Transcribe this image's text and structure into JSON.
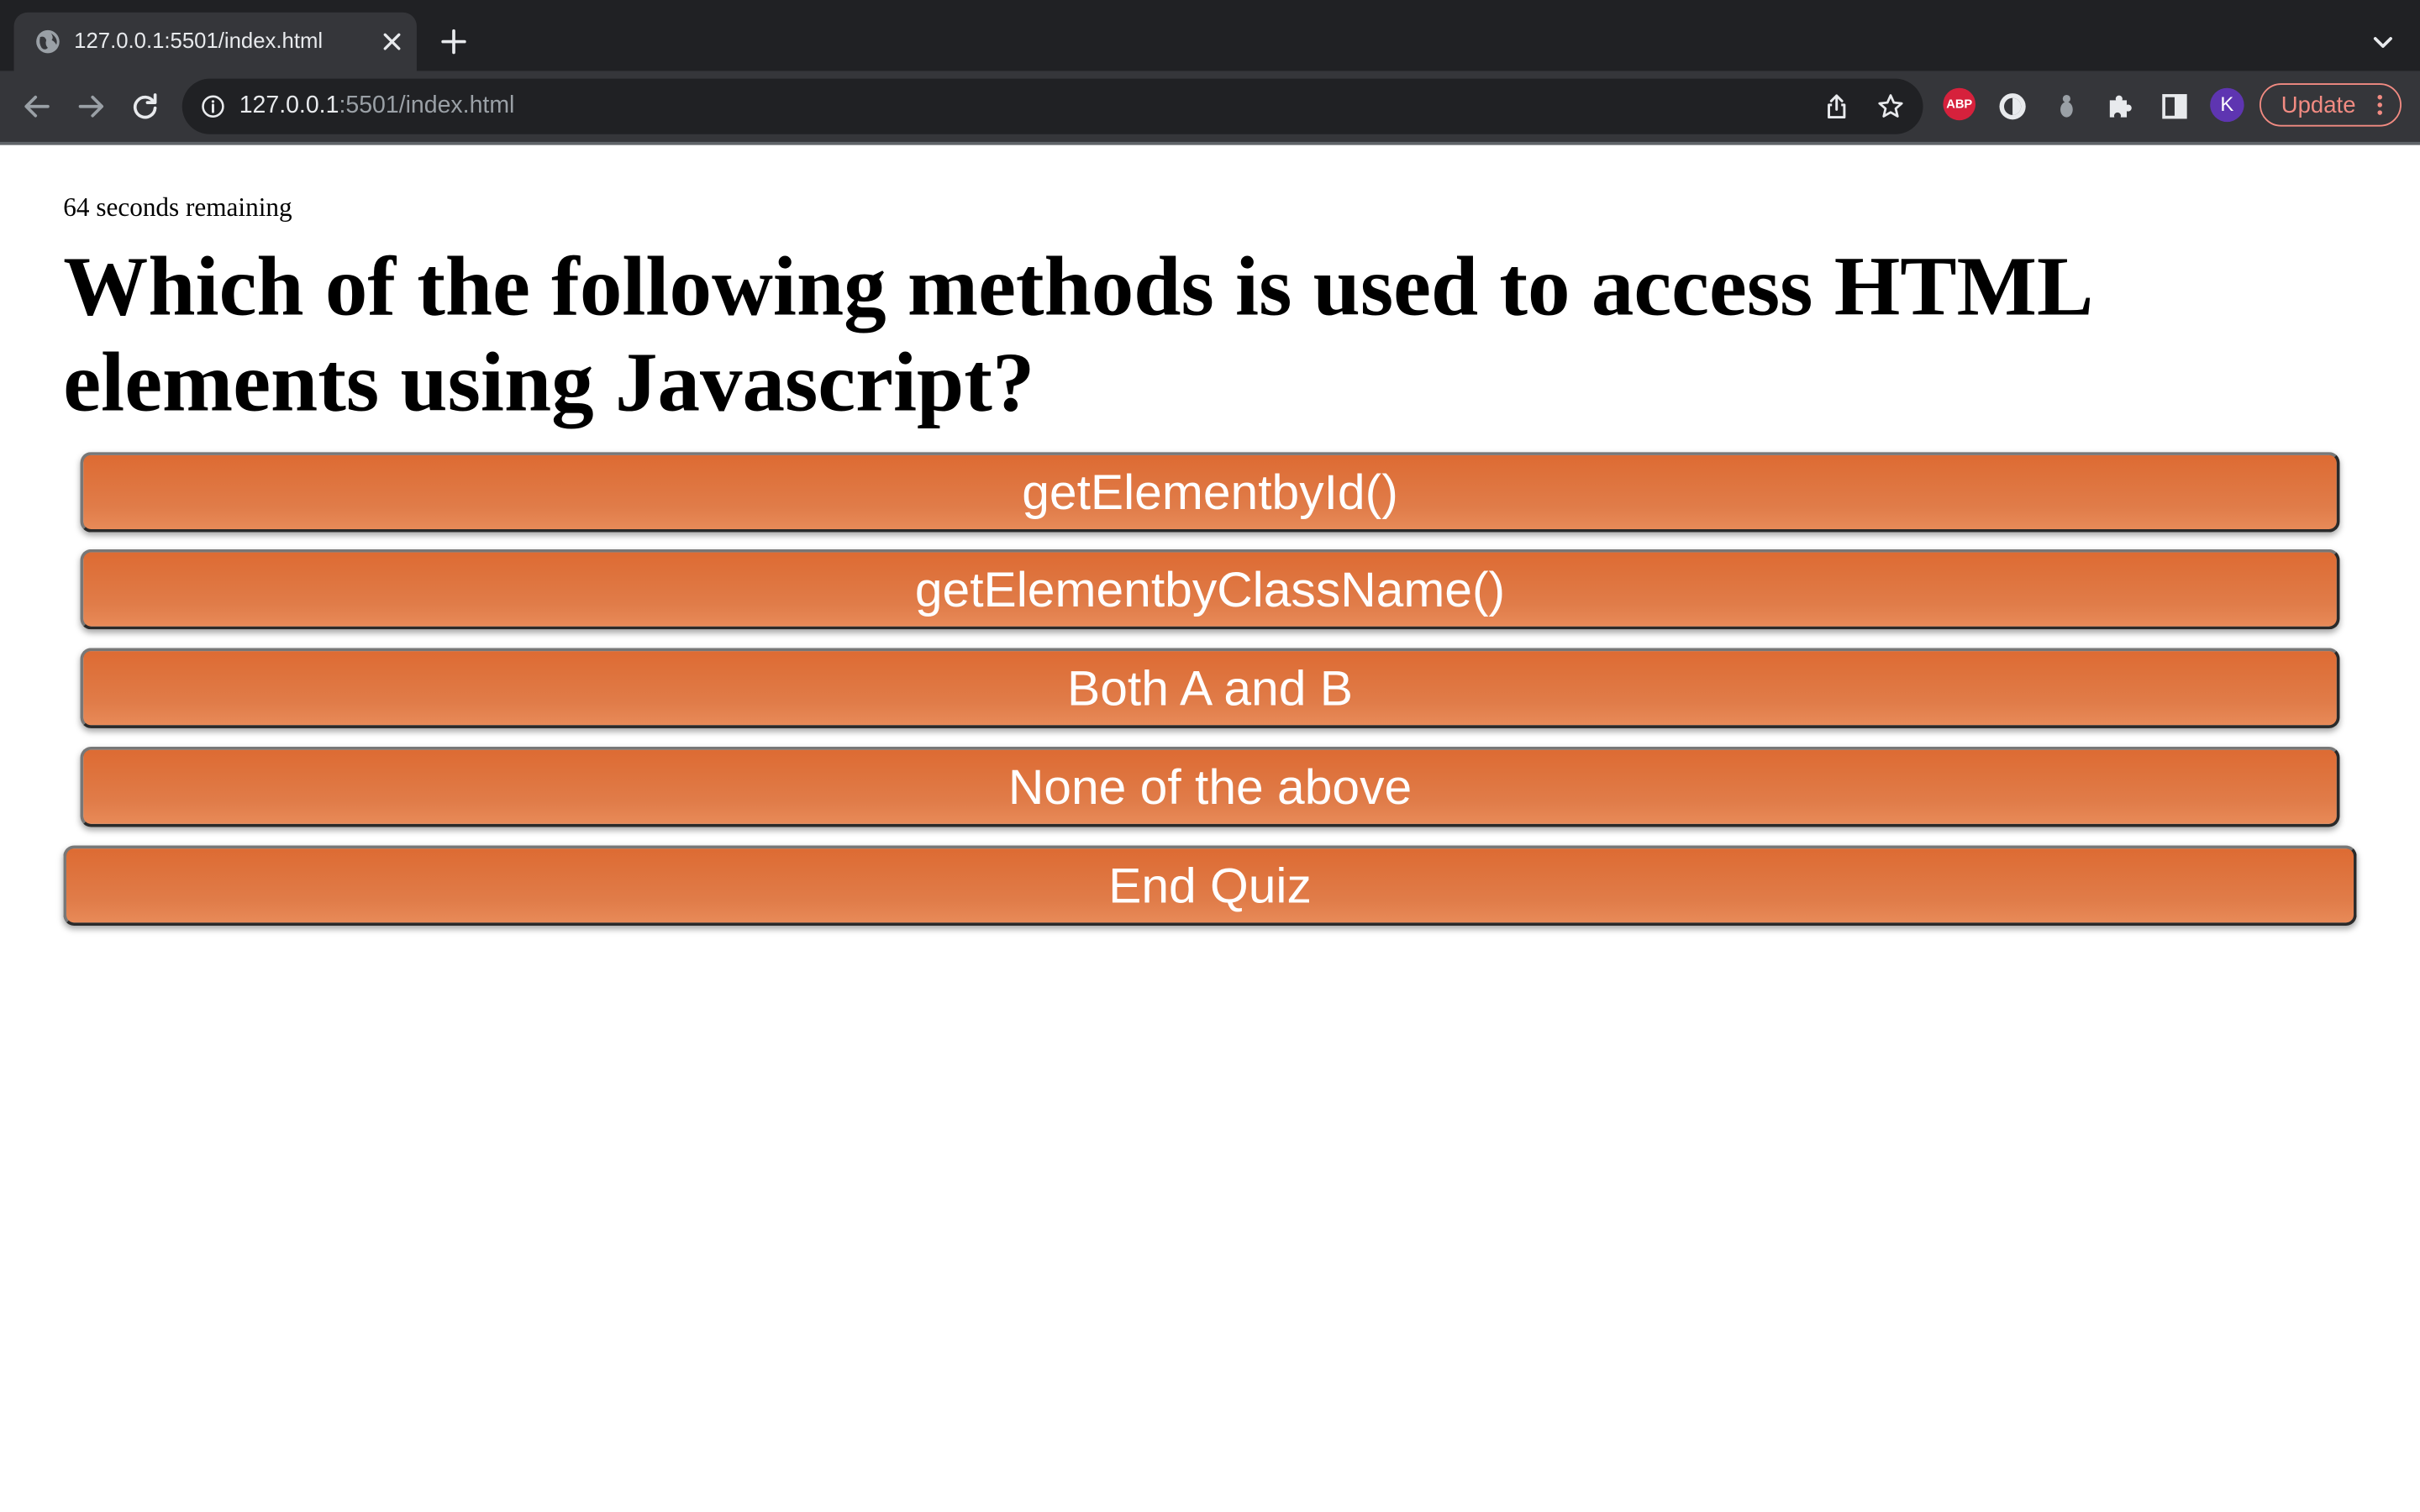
{
  "browser": {
    "tab_title": "127.0.0.1:5501/index.html",
    "url_host": "127.0.0.1",
    "url_rest": ":5501/index.html",
    "extension_abp_label": "ABP",
    "profile_initial": "K",
    "update_label": "Update",
    "accent_color": "#f28b82"
  },
  "quiz": {
    "timer_text": "64 seconds remaining",
    "question": "Which of the following methods is used to access HTML elements using Javascript?",
    "choices": [
      "getElementbyId()",
      "getElementbyClassName()",
      "Both A and B",
      "None of the above"
    ],
    "end_button_label": "End Quiz",
    "button_color": "#e07a45"
  }
}
